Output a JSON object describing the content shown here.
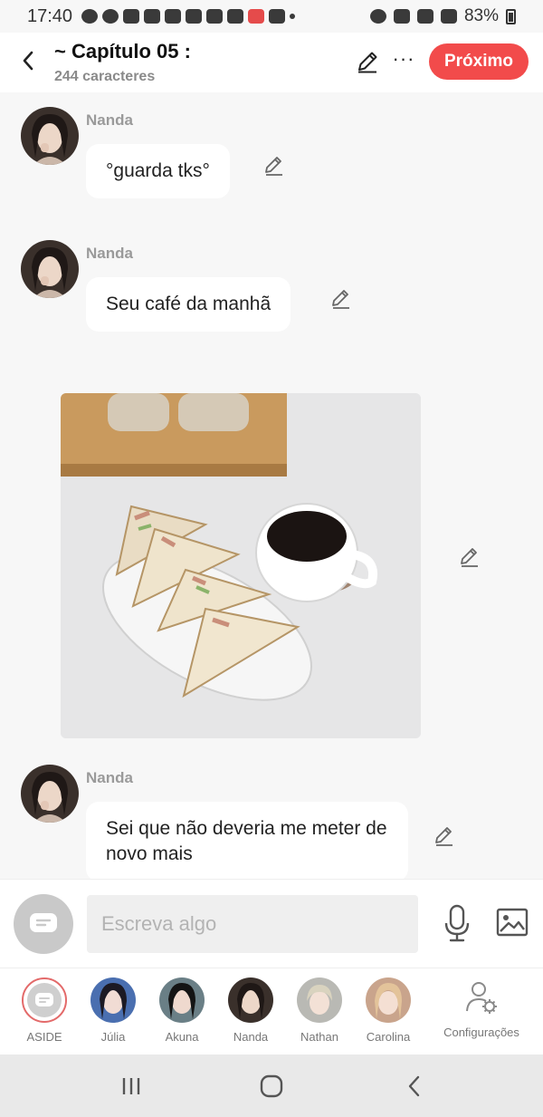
{
  "status_bar": {
    "time": "17:40",
    "battery": "83%"
  },
  "header": {
    "title": "~ Capítulo 05 :",
    "subtitle": "244 caracteres",
    "next_label": "Próximo"
  },
  "messages": [
    {
      "sender": "Nanda",
      "text": "°guarda tks°"
    },
    {
      "sender": "Nanda",
      "text": "Seu café da manhã"
    },
    {
      "sender": "Nanda",
      "text": "Sei que não deveria me meter de novo mais"
    }
  ],
  "input": {
    "placeholder": "Escreva algo"
  },
  "characters": [
    {
      "name": "ASIDE"
    },
    {
      "name": "Júlia"
    },
    {
      "name": "Akuna"
    },
    {
      "name": "Nanda"
    },
    {
      "name": "Nathan"
    },
    {
      "name": "Carolina"
    }
  ],
  "settings_label": "Configurações",
  "colors": {
    "accent": "#f24b4b",
    "background": "#f7f7f7",
    "bubble": "#ffffff"
  },
  "icons": [
    "back-arrow-icon",
    "pencil-icon",
    "more-dots-icon",
    "chat-bubble-icon",
    "microphone-icon",
    "image-icon",
    "user-settings-icon",
    "recent-apps-icon",
    "home-icon",
    "nav-back-icon"
  ]
}
